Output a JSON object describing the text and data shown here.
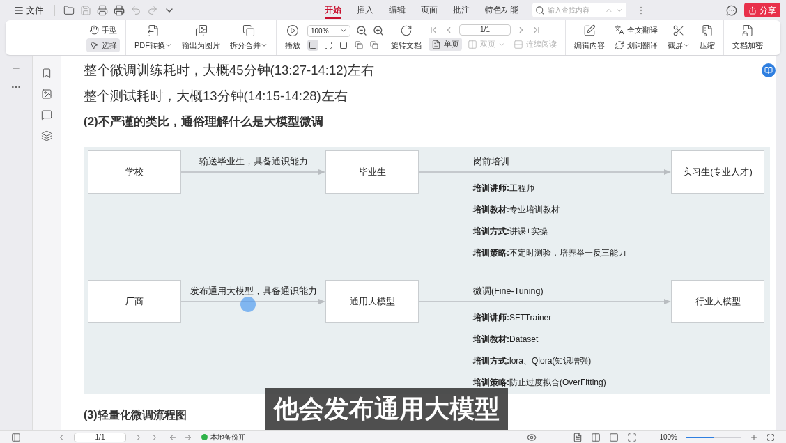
{
  "menu": {
    "file": "文件"
  },
  "tabs": [
    {
      "label": "开始",
      "selected": true
    },
    {
      "label": "插入",
      "selected": false
    },
    {
      "label": "编辑",
      "selected": false
    },
    {
      "label": "页面",
      "selected": false
    },
    {
      "label": "批注",
      "selected": false
    },
    {
      "label": "特色功能",
      "selected": false
    }
  ],
  "search": {
    "placeholder": "输入查找内容"
  },
  "share_button": "分享",
  "toolbar_groups": [
    [
      {
        "kind": "stack",
        "items": [
          {
            "label": "手型",
            "selected": false
          },
          {
            "label": "选择",
            "selected": true
          }
        ]
      }
    ],
    [
      {
        "kind": "large",
        "label": "PDF转换",
        "dropdown": true
      },
      {
        "kind": "large",
        "label": "输出为图片",
        "dropdown": false
      },
      {
        "kind": "large",
        "label": "拆分合并",
        "dropdown": true
      }
    ],
    [
      {
        "kind": "large",
        "label": "播放",
        "dropdown": false
      },
      {
        "kind": "zoom",
        "value": "100%",
        "modes": [
          {
            "selected": true
          },
          {
            "selected": false
          },
          {
            "selected": false
          },
          {
            "selected": false
          },
          {
            "selected": false
          }
        ]
      },
      {
        "kind": "large",
        "label": "旋转文档",
        "dropdown": false
      },
      {
        "kind": "pager",
        "value": "1/1",
        "views": [
          {
            "label": "单页",
            "selected": true,
            "disabled": false,
            "dropdown": false
          },
          {
            "label": "双页",
            "selected": false,
            "disabled": true,
            "dropdown": true
          },
          {
            "label": "连续阅读",
            "selected": false,
            "disabled": true,
            "dropdown": false
          }
        ]
      }
    ],
    [
      {
        "kind": "large",
        "label": "编辑内容",
        "dropdown": false
      },
      {
        "kind": "stack",
        "items": [
          {
            "label": "全文翻译",
            "selected": false
          },
          {
            "label": "划词翻译",
            "selected": false
          }
        ]
      },
      {
        "kind": "large",
        "label": "截屏",
        "dropdown": true
      },
      {
        "kind": "large",
        "label": "压缩",
        "dropdown": false
      }
    ],
    [
      {
        "kind": "large",
        "label": "文档加密",
        "dropdown": false
      }
    ]
  ],
  "document": {
    "lines": [
      "整个微调训练耗时，大概45分钟(13:27-14:12)左右",
      "整个测试耗时，大概13分钟(14:15-14:28)左右"
    ],
    "heading": "(2)不严谨的类比，通俗理解什么是大模型微调",
    "diagram": {
      "rows": [
        {
          "source": "学校",
          "edge_label": "输送毕业生，具备通识能力",
          "middle": "毕业生",
          "stage": "岗前培训",
          "target": "实习生(专业人才)",
          "details": [
            "**培训讲师:**工程师",
            "**培训教材:**专业培训教材",
            "**培训方式:**讲课+实操",
            "**培训策略:**不定时测验，培养举一反三能力"
          ]
        },
        {
          "source": "厂商",
          "edge_label": "发布通用大模型，具备通识能力",
          "middle": "通用大模型",
          "stage": "微调(Fine-Tuning)",
          "target": "行业大模型",
          "details": [
            "**培训讲师:**SFTTrainer",
            "**培训教材:**Dataset",
            "**培训方式:**lora、Qlora(知识增强)",
            "**培训策略:**防止过度拟合(OverFitting)"
          ]
        }
      ]
    },
    "next_heading": "(3)轻量化微调流程图"
  },
  "caption": "他会发布通用大模型",
  "status_bar": {
    "page": "1/1",
    "backup": "本地备份开",
    "zoom": "100%",
    "zoom_slider": {
      "level": 0.5
    }
  }
}
